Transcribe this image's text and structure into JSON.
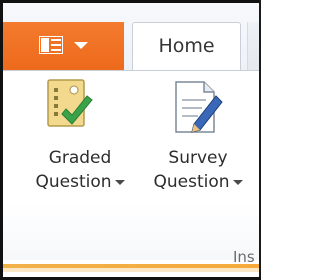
{
  "tabs": {
    "file_icon": "list-icon",
    "home_label": "Home"
  },
  "ribbon": {
    "buttons": [
      {
        "line1": "Graded",
        "line2": "Question",
        "icon": "graded-question-icon"
      },
      {
        "line1": "Survey",
        "line2": "Question",
        "icon": "survey-question-icon"
      }
    ],
    "group_label": "Ins"
  },
  "colors": {
    "file_tab": "#ef6d20",
    "accent_band": "#f4ad40",
    "check": "#3aa34a"
  }
}
